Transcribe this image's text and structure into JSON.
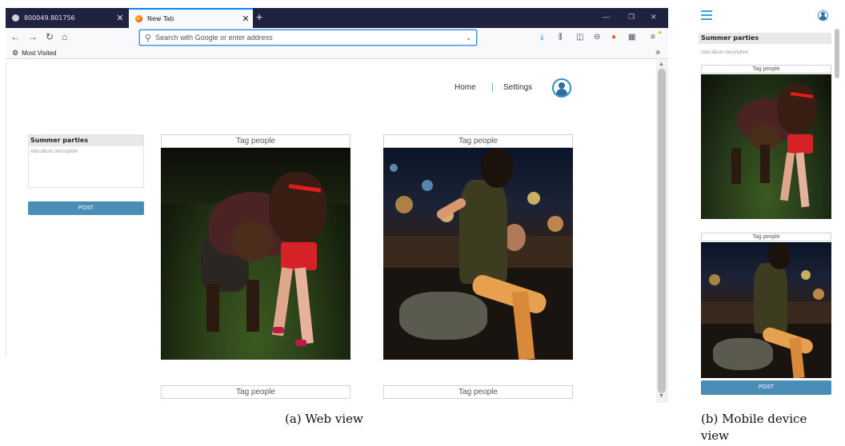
{
  "web": {
    "tabs": [
      {
        "label": "800049.801756",
        "active": false
      },
      {
        "label": "New Tab",
        "active": true
      }
    ],
    "new_tab_glyph": "+",
    "window_controls": [
      "—",
      "❐",
      "✕"
    ],
    "address_placeholder": "Search with Google or enter address",
    "bookmarks_label": "Most Visited",
    "site_nav": {
      "home": "Home",
      "separator": "|",
      "settings": "Settings"
    },
    "album": {
      "title": "Summer parties",
      "description_placeholder": "Add album description",
      "post_label": "POST"
    },
    "cards": [
      {
        "tag_label": "Tag people"
      },
      {
        "tag_label": "Tag people"
      },
      {
        "tag_label": "Tag people"
      },
      {
        "tag_label": "Tag people"
      }
    ],
    "colors": {
      "accent": "#4a8db7",
      "tab_bar": "#202340",
      "nav_separator": "#58a3d6"
    }
  },
  "mobile": {
    "album": {
      "title": "Summer parties",
      "description_placeholder": "Add album description",
      "post_label": "POST"
    },
    "cards": [
      {
        "tag_label": "Tag people"
      },
      {
        "tag_label": "Tag people"
      }
    ]
  },
  "captions": {
    "web": "(a) Web view",
    "mobile_line1": "(b)  Mobile device",
    "mobile_line2": "view"
  },
  "icons": [
    "back-arrow-icon",
    "forward-arrow-icon",
    "reload-icon",
    "home-icon",
    "search-icon",
    "download-icon",
    "library-icon",
    "sidebar-icon",
    "account-icon",
    "addon-icon",
    "menu-icon",
    "gear-icon",
    "hamburger-icon",
    "user-avatar-icon"
  ]
}
